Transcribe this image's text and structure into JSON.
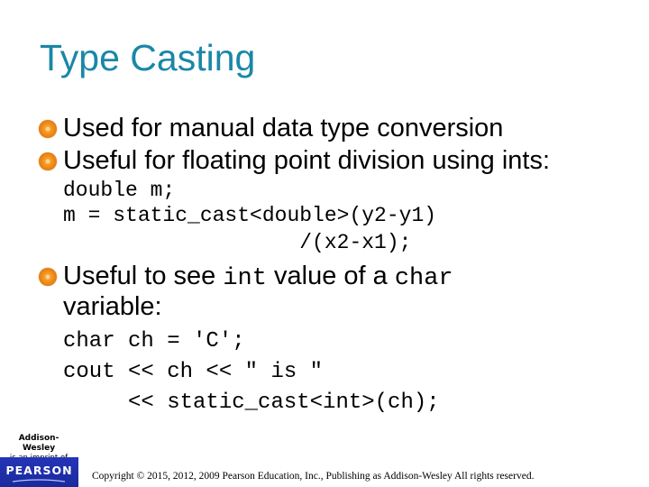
{
  "slide": {
    "title": "Type Casting",
    "bullets": [
      {
        "text": "Used for manual data type conversion"
      },
      {
        "text": "Useful for floating point division using ints:"
      },
      {
        "parts": [
          "Useful to see ",
          "int",
          " value of a ",
          "char"
        ],
        "continuation": "variable:"
      }
    ],
    "code_block_1": [
      "double m;",
      "m = static_cast<double>(y2-y1)",
      "                   /(x2-x1);"
    ],
    "code_block_2": [
      "char ch = 'C';",
      "cout << ch << \" is \"",
      "     << static_cast<int>(ch);"
    ]
  },
  "footer": {
    "logo_publisher": "Addison-Wesley",
    "logo_imprint_text": "is an imprint of",
    "logo_brand": "PEARSON",
    "copyright": "Copyright © 2015, 2012, 2009 Pearson Education, Inc., Publishing as Addison-Wesley All rights reserved."
  }
}
